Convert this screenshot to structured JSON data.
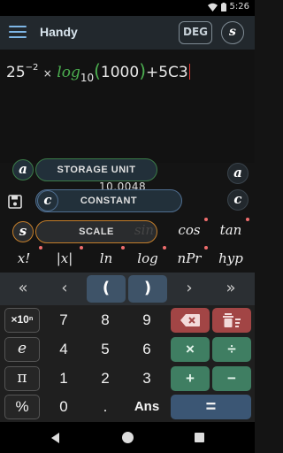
{
  "status_bar": {
    "time": "5:26"
  },
  "app_bar": {
    "title": "Handy",
    "angle_mode": "DEG",
    "s_label": "s"
  },
  "display": {
    "expression": {
      "base": "25",
      "exponent": "−2",
      "times": "×",
      "log_fn": "log",
      "log_base": "10",
      "open_paren": "(",
      "argument": "1000",
      "close_paren": ")",
      "plus_term": "+5C3"
    }
  },
  "overlay": {
    "partial_result": "10.0048",
    "storage_unit": "STORAGE UNIT",
    "constant": "CONSTANT",
    "scale": "SCALE",
    "a_label": "a",
    "c_label": "c",
    "s_label": "s"
  },
  "function_row_1": [
    "sin",
    "cos",
    "tan"
  ],
  "function_row_2": [
    "x!",
    "|x|",
    "ln",
    "log",
    "nPr",
    "hyp"
  ],
  "nav_row": [
    "«",
    "‹",
    "(",
    ")",
    "›",
    "»"
  ],
  "keypad": {
    "row1": [
      "×10ⁿ",
      "7",
      "8",
      "9"
    ],
    "row2": [
      "e",
      "4",
      "5",
      "6",
      "×",
      "÷"
    ],
    "row3": [
      "π",
      "1",
      "2",
      "3",
      "+",
      "−"
    ],
    "row4": [
      "%",
      "0",
      ".",
      "Ans",
      "="
    ]
  },
  "colors": {
    "accent_green": "#4caf50",
    "cursor_red": "#e53935",
    "scale_orange": "#c47e2a",
    "paren_blue": "#3e5368"
  }
}
